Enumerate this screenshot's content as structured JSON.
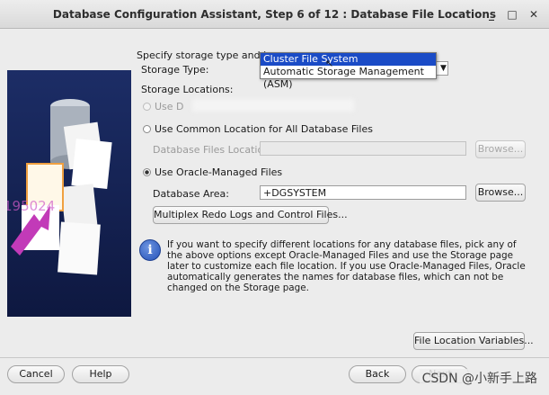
{
  "window": {
    "title": "Database Configuration Assistant, Step 6 of 12 : Database File Locations",
    "minimize_glyph": "_",
    "maximize_glyph": "□",
    "close_glyph": "✕"
  },
  "form": {
    "intro": "Specify storage type and loca",
    "storage_type_label": "Storage Type:",
    "storage_locations_label": "Storage Locations:",
    "option_template_label": "Use D",
    "option_common_label": "Use Common Location for All Database Files",
    "database_files_location_label": "Database Files Location:",
    "database_files_location_value": "",
    "browse_label_1": "Browse...",
    "option_omf_label": "Use Oracle-Managed Files",
    "database_area_label": "Database Area:",
    "database_area_value": "+DGSYSTEM",
    "browse_label_2": "Browse...",
    "multiplex_label": "Multiplex Redo Logs and Control Files..."
  },
  "storage_dropdown": {
    "options": [
      "Cluster File System",
      "Automatic Storage Management (ASM)"
    ],
    "highlighted_index": 0
  },
  "info": {
    "icon": "info-icon",
    "glyph": "i",
    "text": "If you want to specify different locations for any database files, pick any of the above options except Oracle-Managed Files and use the Storage page later to customize each file location. If you use Oracle-Managed Files, Oracle automatically generates the names for database files, which can not be changed on the Storage page."
  },
  "footer": {
    "file_location_variables_label": "File Location Variables...",
    "cancel_label": "Cancel",
    "help_label": "Help",
    "back_label": "Back",
    "next_label": "Next"
  },
  "panel": {
    "side_text": "195024"
  },
  "watermark": "CSDN @小新手上路"
}
